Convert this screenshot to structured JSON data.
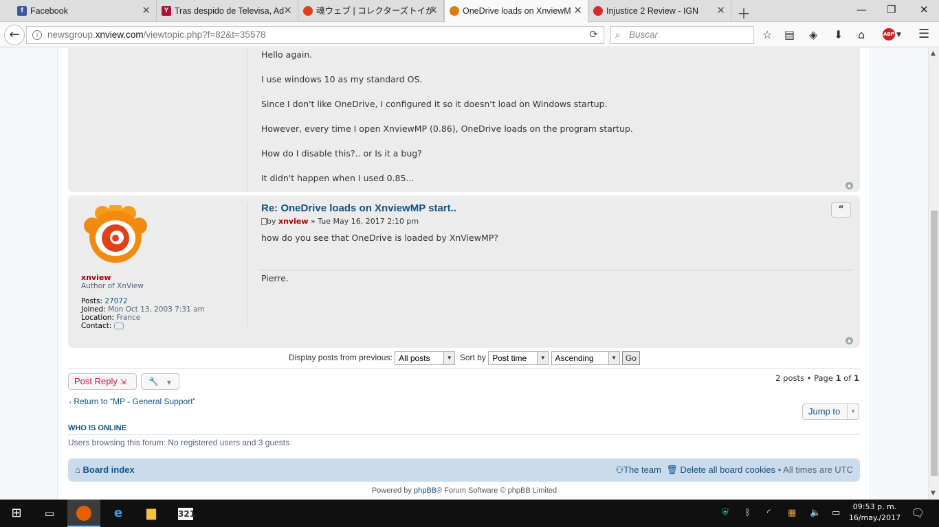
{
  "browser": {
    "tabs": [
      {
        "title": "Facebook",
        "favicon": "facebook-icon",
        "color": "#3b5998",
        "letter": "f"
      },
      {
        "title": "Tras despido de Televisa, Ad",
        "favicon": "news-icon",
        "color": "#b01030",
        "letter": "Y"
      },
      {
        "title": "魂ウェブ | コレクターズトイが",
        "favicon": "flame-icon",
        "color": "#e0401a",
        "letter": "🔥"
      },
      {
        "title": "OneDrive loads on XnviewM",
        "favicon": "xnview-icon",
        "color": "#e07a10",
        "letter": "◉",
        "active": true
      },
      {
        "title": "Injustice 2 Review - IGN",
        "favicon": "ign-icon",
        "color": "#d42a2a",
        "letter": "✱"
      }
    ],
    "url_prefix": "newsgroup.",
    "url_host": "xnview.com",
    "url_path": "/viewtopic.php?f=82&t=35578",
    "search_placeholder": "Buscar",
    "abp_label": "ABP"
  },
  "posts": [
    {
      "lines": [
        "Hello again.",
        "I use windows 10 as my standard OS.",
        "Since I don't like OneDrive, I configured it so it doesn't load on Windows startup.",
        "However, every time I open XnviewMP (0.86), OneDrive loads on the program startup.",
        "How do I disable this?.. or Is it a bug?",
        "It didn't happen when I used 0.85..."
      ]
    },
    {
      "title": "Re: OneDrive loads on XnviewMP start..",
      "by": "by",
      "author": "xnview",
      "date": "» Tue May 16, 2017 2:10 pm",
      "body": "how do you see that OneDrive is loaded by XnViewMP?",
      "signature": "Pierre.",
      "quote_label": "“",
      "profile": {
        "username": "xnview",
        "rank": "Author of XnView",
        "posts_label": "Posts:",
        "posts": "27072",
        "joined_label": "Joined:",
        "joined": "Mon Oct 13, 2003 7:31 am",
        "location_label": "Location:",
        "location": "France",
        "contact_label": "Contact:"
      }
    }
  ],
  "sortbar": {
    "display_label": "Display posts from previous:",
    "display_value": "All posts",
    "sort_label": "Sort by",
    "sort_value": "Post time",
    "order_value": "Ascending",
    "go": "Go"
  },
  "actions": {
    "post_reply": "Post Reply",
    "pagination_pre": "2 posts • Page",
    "page": "1",
    "of": "of",
    "total_pages": "1",
    "return_link": "Return to “MP - General Support”",
    "jump_to": "Jump to"
  },
  "online": {
    "heading": "WHO IS ONLINE",
    "text": "Users browsing this forum: No registered users and 3 guests"
  },
  "footer": {
    "board_index": "Board index",
    "team": "The team",
    "delete_cookies": "Delete all board cookies",
    "times": "• All times are UTC",
    "powered_pre": "Powered by",
    "powered_link": "phpBB",
    "powered_post": "® Forum Software © phpBB Limited"
  },
  "taskbar": {
    "time": "09:53 p. m.",
    "date": "16/may./2017"
  },
  "colors": {
    "link": "#105289",
    "author": "#aa0000",
    "post_bg": "#ececec",
    "footer_bg": "#cadceb"
  }
}
